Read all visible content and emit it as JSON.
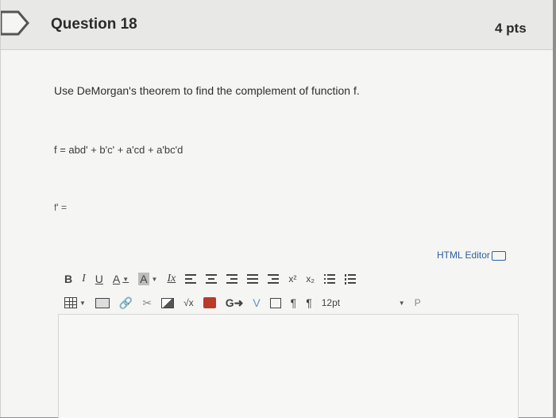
{
  "question": {
    "title": "Question 18",
    "points": "4 pts",
    "prompt": "Use DeMorgan's theorem to find the complement of function f.",
    "function": "f = abd' + b'c' + a'cd + a'bc'd",
    "answer_label": "f' ="
  },
  "editor": {
    "html_editor_label": "HTML Editor",
    "font_size": "12pt",
    "paragraph_placeholder": "P",
    "row1": [
      "B",
      "I",
      "U",
      "A",
      "A",
      "Ix",
      "x²",
      "x₂"
    ],
    "colors": {
      "link": "#2f5fa0",
      "text": "#2d2d2d"
    }
  }
}
